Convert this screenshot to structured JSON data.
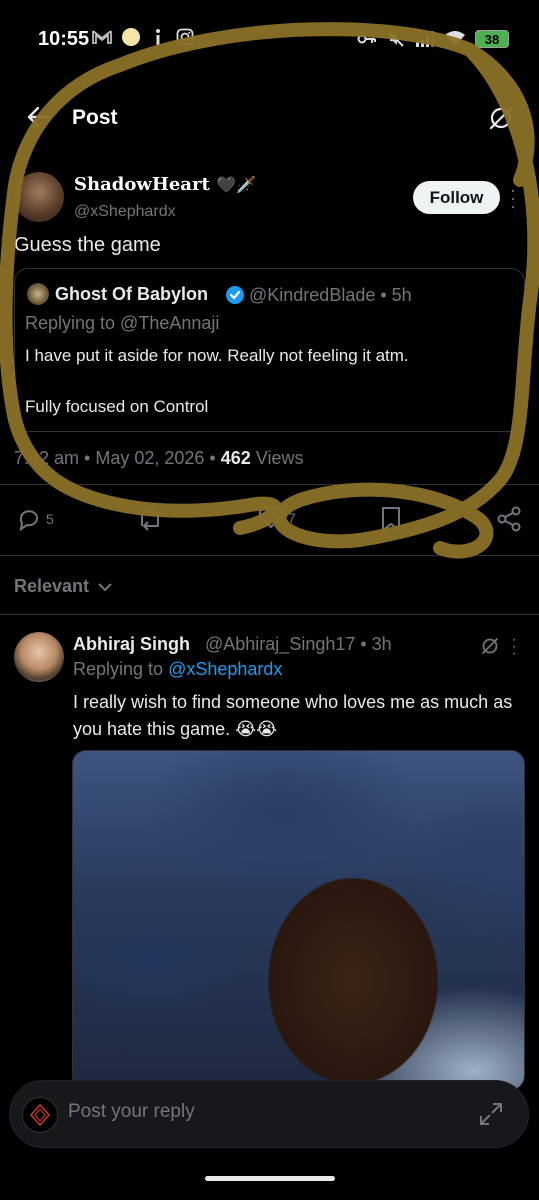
{
  "status_bar": {
    "time": "10:55",
    "battery": "38",
    "icons": [
      "gmail-icon",
      "notification-dot-icon",
      "info-icon",
      "instagram-icon",
      "key-icon",
      "mute-icon",
      "signal-icon",
      "wifi-icon",
      "battery-icon"
    ]
  },
  "header": {
    "title": "Post"
  },
  "post": {
    "display_name": "ShadowHeart",
    "name_emojis": "🖤🗡️",
    "handle": "@xShephardx",
    "follow_label": "Follow",
    "text": "Guess the game",
    "quote": {
      "name": "Ghost Of Babylon",
      "meta": "@KindredBlade • 5h",
      "replying_to": "Replying to @TheAnnaji",
      "body_line1": "I have put it aside for now. Really not feeling it atm.",
      "body_line2": "Fully focused on Control"
    },
    "time_date": "7:02 am • May 02, 2026 •",
    "views_count": "462",
    "views_label": "Views",
    "actions": {
      "replies": "5",
      "reposts": "",
      "likes": "7"
    }
  },
  "replies_section": {
    "sort_label": "Relevant"
  },
  "reply": {
    "name": "Abhiraj Singh",
    "meta": "@Abhiraj_Singh17 • 3h",
    "replying_prefix": "Replying to",
    "replying_handle": "@xShephardx",
    "body": "I really wish to find someone who loves me as much as you hate this game. 😭😭"
  },
  "composer": {
    "placeholder": "Post your reply"
  },
  "colors": {
    "background": "#000000",
    "text": "#e7e9ea",
    "muted": "#71767b",
    "accent": "#1d9bf0",
    "verified": "#1d9bf0",
    "annotation": "#8a7027"
  }
}
